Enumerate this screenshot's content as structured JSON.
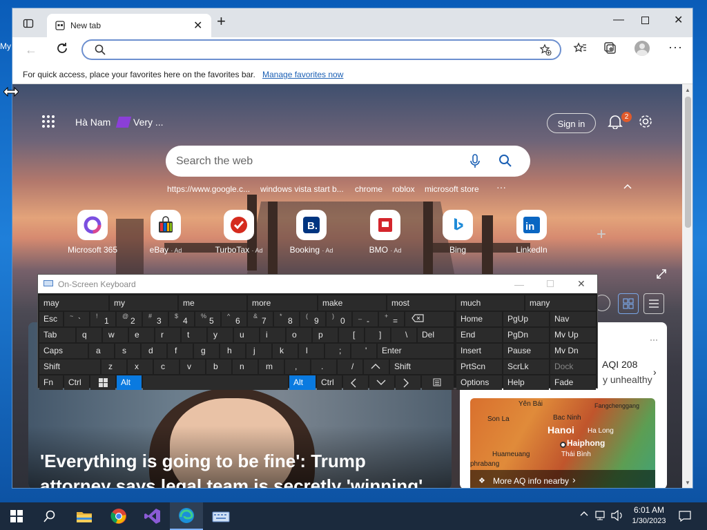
{
  "desktop": {
    "left_label": "My"
  },
  "browser": {
    "tab": {
      "title": "New tab"
    },
    "address": {
      "value": ""
    },
    "favbar": {
      "text": "For quick access, place your favorites here on the favorites bar.",
      "link": "Manage favorites now"
    }
  },
  "newtab": {
    "location": "Hà Nam",
    "weather": "Very ...",
    "signin": "Sign in",
    "notif_count": "2",
    "search_placeholder": "Search the web",
    "quick_links": [
      "https://www.google.c...",
      "windows vista start b...",
      "chrome",
      "roblox",
      "microsoft store"
    ],
    "more": "···",
    "tiles": [
      {
        "label": "Microsoft 365",
        "ad": ""
      },
      {
        "label": "eBay",
        "ad": "· Ad"
      },
      {
        "label": "TurboTax",
        "ad": "· Ad"
      },
      {
        "label": "Booking",
        "ad": "· Ad"
      },
      {
        "label": "BMO",
        "ad": "· Ad"
      },
      {
        "label": "Bing",
        "ad": ""
      },
      {
        "label": "LinkedIn",
        "ad": ""
      }
    ],
    "headline": "'Everything is going to be fine': Trump attorney says legal team is secretly 'winning'",
    "aqi": {
      "value": "AQI 208",
      "status": "y unhealthy",
      "more": "More AQ info nearby"
    },
    "map_places": [
      "Yên Bái",
      "Fangchenggang",
      "Son La",
      "Bac Ninh",
      "Hanoi",
      "Ha Long",
      "Haiphong",
      "Thái Bình",
      "Huameuang",
      "phrabang"
    ]
  },
  "osk": {
    "title": "On-Screen Keyboard",
    "predictions": [
      "may",
      "my",
      "me",
      "more",
      "make",
      "most",
      "much",
      "many"
    ],
    "row1": [
      [
        "Esc",
        ""
      ],
      [
        "`",
        "~"
      ],
      [
        "1",
        "!"
      ],
      [
        "2",
        "@"
      ],
      [
        "3",
        "#"
      ],
      [
        "4",
        "$"
      ],
      [
        "5",
        "%"
      ],
      [
        "6",
        "^"
      ],
      [
        "7",
        "&"
      ],
      [
        "8",
        "*"
      ],
      [
        "9",
        "("
      ],
      [
        "0",
        ")"
      ],
      [
        "-",
        "_"
      ],
      [
        "=",
        "+"
      ]
    ],
    "row2": [
      "Tab",
      "q",
      "w",
      "e",
      "r",
      "t",
      "y",
      "u",
      "i",
      "o",
      "p",
      "[",
      "]",
      "\\",
      "Del"
    ],
    "row3": [
      "Caps",
      "a",
      "s",
      "d",
      "f",
      "g",
      "h",
      "j",
      "k",
      "l",
      ";",
      "'",
      "Enter"
    ],
    "row4": [
      "Shift",
      "z",
      "x",
      "c",
      "v",
      "b",
      "n",
      "m",
      ",",
      ".",
      "/",
      "Shift"
    ],
    "row5": [
      "Fn",
      "Ctrl",
      "Alt",
      "Alt",
      "Ctrl"
    ],
    "nav": [
      "Home",
      "PgUp",
      "Nav",
      "End",
      "PgDn",
      "Mv Up",
      "Insert",
      "Pause",
      "Mv Dn",
      "PrtScn",
      "ScrLk",
      "Dock",
      "Options",
      "Help",
      "Fade"
    ]
  },
  "taskbar": {
    "time": "6:01 AM",
    "date": "1/30/2023"
  }
}
